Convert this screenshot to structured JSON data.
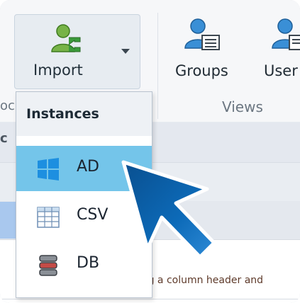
{
  "ribbon": {
    "import_label": "Import",
    "groups_label": "Groups",
    "users_label": "User",
    "views_group_label": "Views",
    "left_group_fragment": "oc"
  },
  "list": {
    "left_fragment": "c"
  },
  "dropdown": {
    "header": "Instances",
    "items": [
      {
        "label": "AD",
        "icon": "windows-icon",
        "selected": true
      },
      {
        "label": "CSV",
        "icon": "csv-grid-icon",
        "selected": false
      },
      {
        "label": "DB",
        "icon": "database-icon",
        "selected": false
      }
    ]
  },
  "content": {
    "drag_hint": "ag a column header and"
  },
  "colors": {
    "selected_item": "#74c5ea",
    "windows_blue": "#1d8fe0",
    "cursor_blue": "#0c5fa8",
    "import_group_bg": "#e7ecf1"
  }
}
